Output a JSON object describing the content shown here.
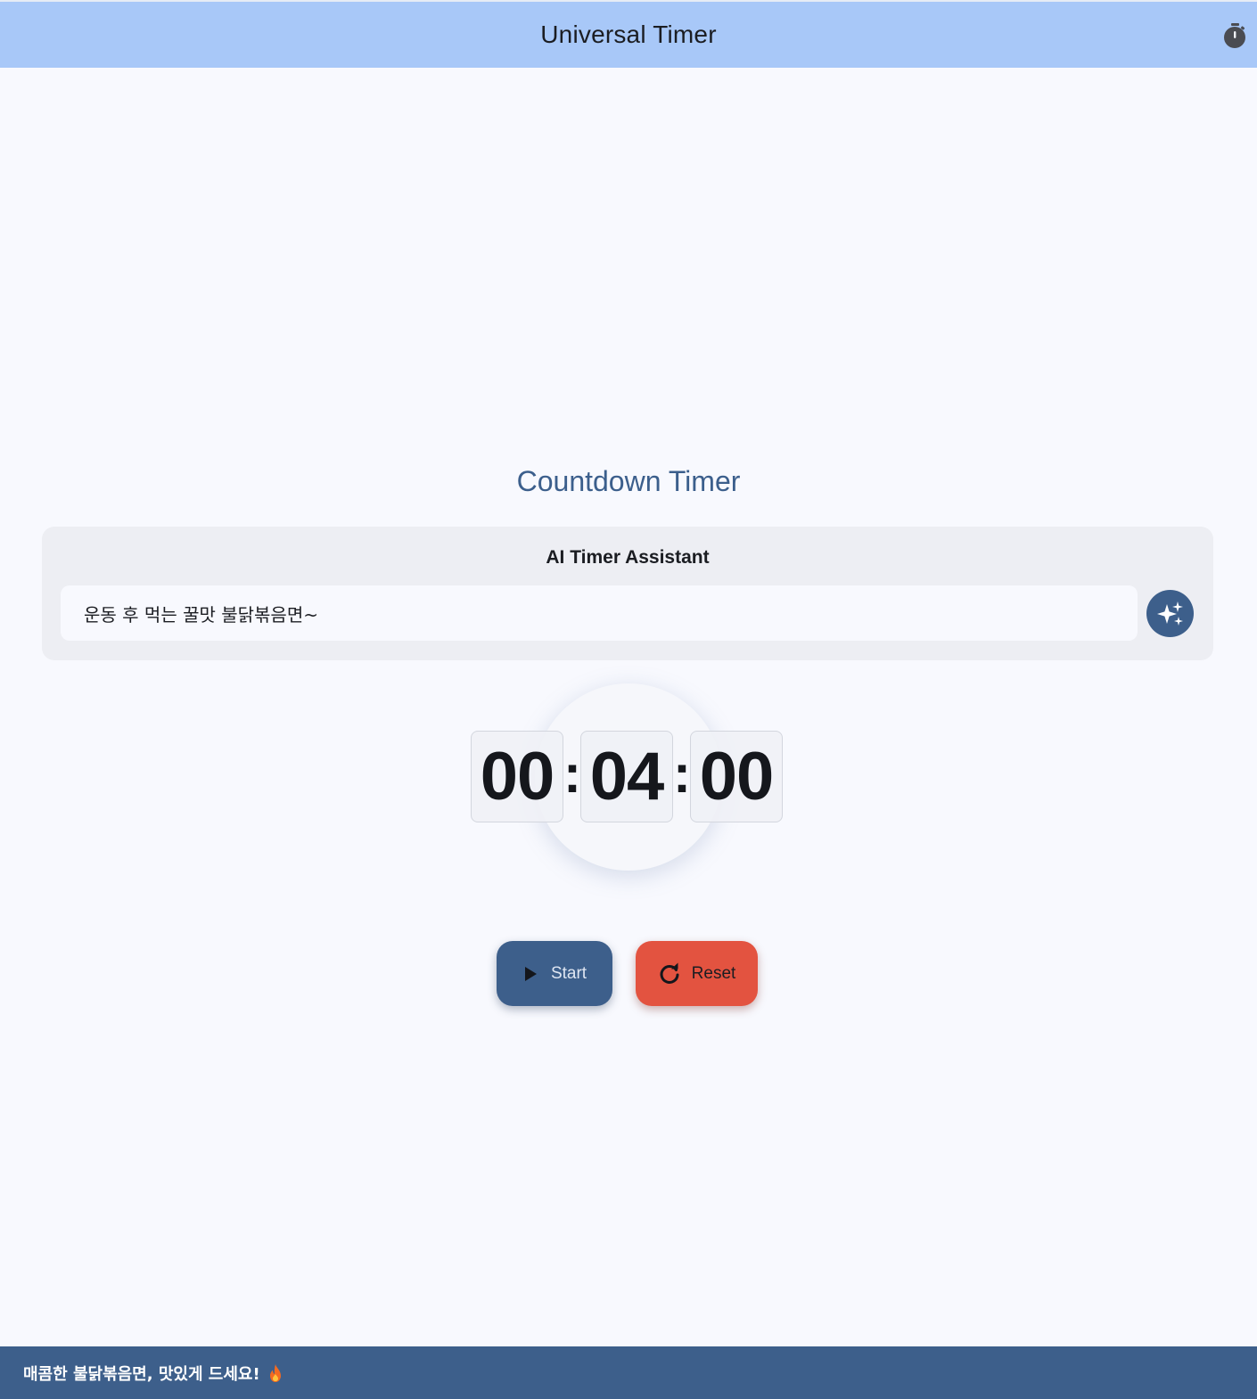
{
  "app_bar": {
    "title": "Universal Timer",
    "icon": "stopwatch-icon"
  },
  "main": {
    "section_title": "Countdown Timer",
    "assistant": {
      "label": "AI Timer Assistant",
      "input_value": "운동 후 먹는 꿀맛 불닭볶음면~",
      "button_icon": "sparkle-icon"
    },
    "timer": {
      "hours": "00",
      "minutes": "04",
      "seconds": "00",
      "separator": ":"
    },
    "controls": {
      "start_label": "Start",
      "start_icon": "play-icon",
      "reset_label": "Reset",
      "reset_icon": "refresh-icon"
    }
  },
  "snackbar": {
    "message": "매콤한 불닭볶음면, 맛있게 드세요!",
    "icon": "fire-icon"
  },
  "colors": {
    "app_bar": "#a8c8f8",
    "primary": "#3d5f8b",
    "reset": "#e35340",
    "background": "#f8f9fe"
  }
}
